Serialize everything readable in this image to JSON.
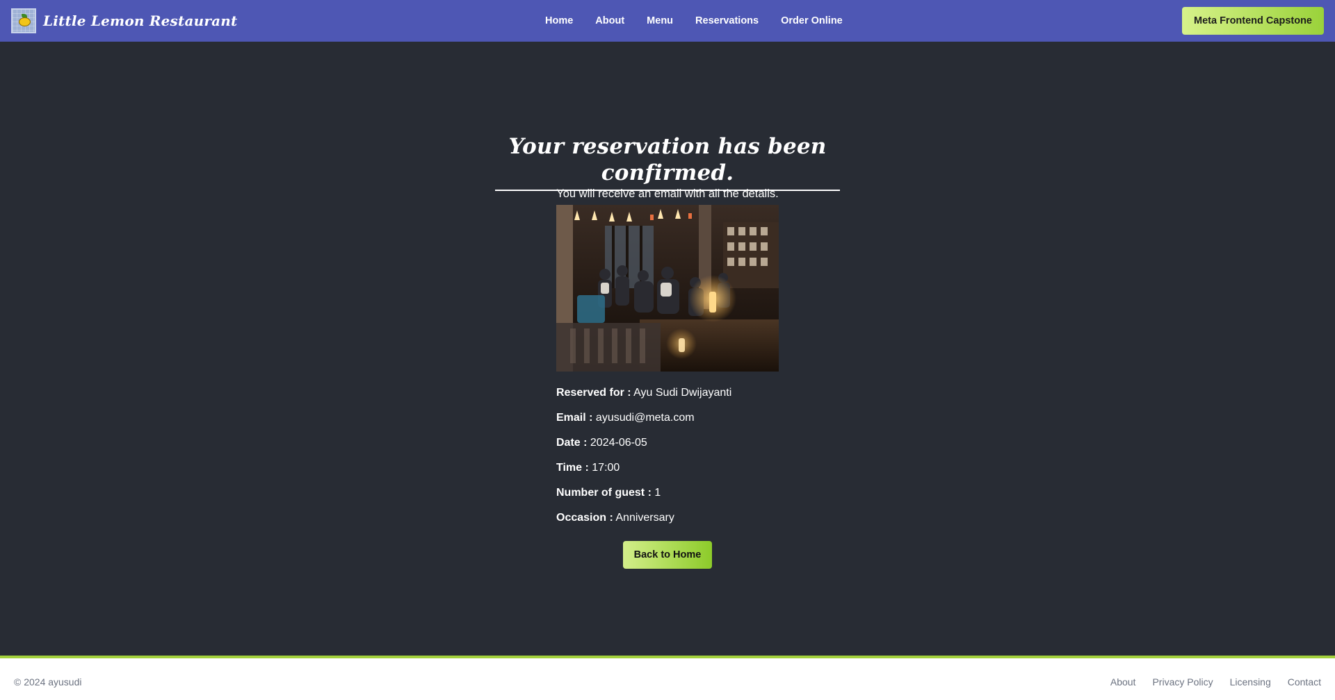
{
  "header": {
    "brand_name": "Little Lemon Restaurant",
    "nav": [
      "Home",
      "About",
      "Menu",
      "Reservations",
      "Order Online"
    ],
    "cta_label": "Meta Frontend Capstone"
  },
  "confirmation": {
    "title": "Your reservation has been confirmed.",
    "subtitle": "You will receive an email with all the details.",
    "details": [
      {
        "label": "Reserved for :",
        "value": "Ayu Sudi Dwijayanti"
      },
      {
        "label": "Email :",
        "value": "ayusudi@meta.com"
      },
      {
        "label": "Date :",
        "value": "2024-06-05"
      },
      {
        "label": "Time :",
        "value": "17:00"
      },
      {
        "label": "Number of guest :",
        "value": "1"
      },
      {
        "label": "Occasion :",
        "value": "Anniversary"
      }
    ],
    "back_button_label": "Back to Home"
  },
  "footer": {
    "copyright": "© 2024 ayusudi",
    "links": [
      "About",
      "Privacy Policy",
      "Licensing",
      "Contact"
    ]
  },
  "colors": {
    "header_bg": "#4e57b4",
    "page_bg": "#282c34",
    "accent_green": "#9ad23a"
  }
}
